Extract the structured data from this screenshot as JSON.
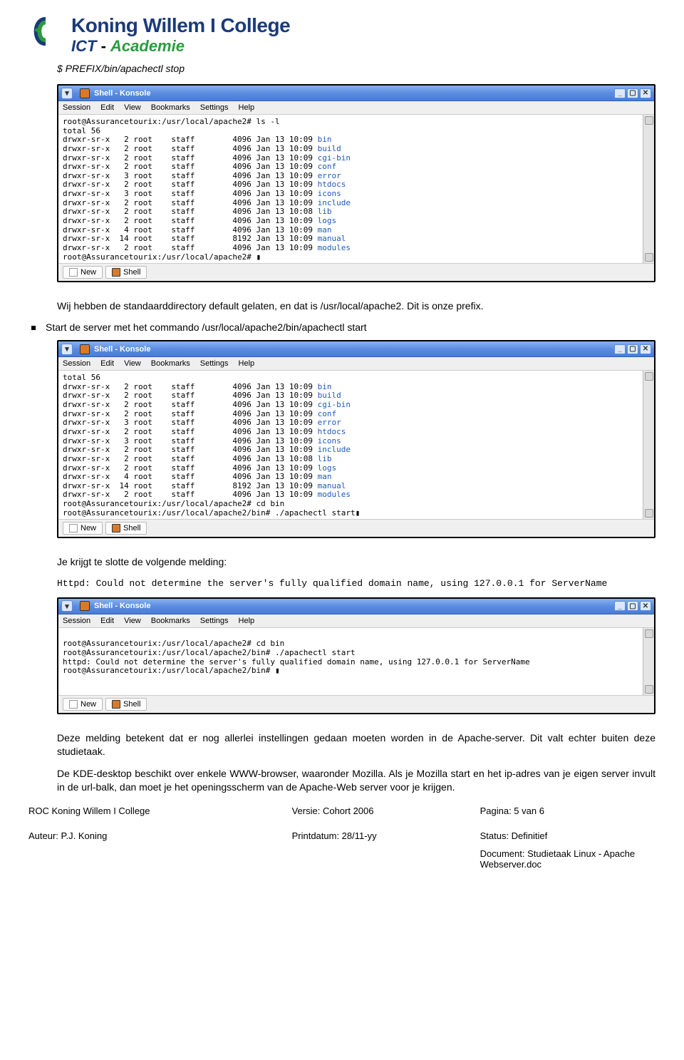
{
  "logo": {
    "title": "Koning Willem I College",
    "sub_ict": "ICT",
    "sub_dash": " - ",
    "sub_acad": "Academie"
  },
  "cmd_stop": "$ PREFIX/bin/apachectl stop",
  "para_prefix": "Wij hebben de standaarddirectory default gelaten, en dat is /usr/local/apache2. Dit is onze prefix.",
  "bullet_start": "Start de server met het commando /usr/local/apache2/bin/apachectl start",
  "para_slotte": "Je krijgt te slotte de volgende melding:",
  "mono_msg": "Httpd: Could not determine the server's fully qualified domain name, using 127.0.0.1 for ServerName",
  "para_melding": "Deze melding betekent dat er nog allerlei instellingen gedaan moeten worden in de Apache-server. Dit valt echter buiten deze studietaak.",
  "para_kde": "De KDE-desktop beschikt over enkele WWW-browser, waaronder Mozilla. Als je Mozilla start en het ip-adres van je eigen server invult in de url-balk, dan moet je het openingsscherm van de Apache-Web server voor je krijgen.",
  "konsole": {
    "title": "Shell - Konsole",
    "menu": [
      "Session",
      "Edit",
      "View",
      "Bookmarks",
      "Settings",
      "Help"
    ],
    "tabs": {
      "new": "New",
      "shell": "Shell"
    }
  },
  "term1": {
    "prompt1": "root@Assurancetourix:/usr/local/apache2# ls -l",
    "total": "total 56",
    "rows": [
      {
        "perm": "drwxr-sr-x",
        "n": "2",
        "own": "root",
        "grp": "staff",
        "size": "4096",
        "date": "Jan 13 10:09",
        "name": "bin"
      },
      {
        "perm": "drwxr-sr-x",
        "n": "2",
        "own": "root",
        "grp": "staff",
        "size": "4096",
        "date": "Jan 13 10:09",
        "name": "build"
      },
      {
        "perm": "drwxr-sr-x",
        "n": "2",
        "own": "root",
        "grp": "staff",
        "size": "4096",
        "date": "Jan 13 10:09",
        "name": "cgi-bin"
      },
      {
        "perm": "drwxr-sr-x",
        "n": "2",
        "own": "root",
        "grp": "staff",
        "size": "4096",
        "date": "Jan 13 10:09",
        "name": "conf"
      },
      {
        "perm": "drwxr-sr-x",
        "n": "3",
        "own": "root",
        "grp": "staff",
        "size": "4096",
        "date": "Jan 13 10:09",
        "name": "error"
      },
      {
        "perm": "drwxr-sr-x",
        "n": "2",
        "own": "root",
        "grp": "staff",
        "size": "4096",
        "date": "Jan 13 10:09",
        "name": "htdocs"
      },
      {
        "perm": "drwxr-sr-x",
        "n": "3",
        "own": "root",
        "grp": "staff",
        "size": "4096",
        "date": "Jan 13 10:09",
        "name": "icons"
      },
      {
        "perm": "drwxr-sr-x",
        "n": "2",
        "own": "root",
        "grp": "staff",
        "size": "4096",
        "date": "Jan 13 10:09",
        "name": "include"
      },
      {
        "perm": "drwxr-sr-x",
        "n": "2",
        "own": "root",
        "grp": "staff",
        "size": "4096",
        "date": "Jan 13 10:08",
        "name": "lib"
      },
      {
        "perm": "drwxr-sr-x",
        "n": "2",
        "own": "root",
        "grp": "staff",
        "size": "4096",
        "date": "Jan 13 10:09",
        "name": "logs"
      },
      {
        "perm": "drwxr-sr-x",
        "n": "4",
        "own": "root",
        "grp": "staff",
        "size": "4096",
        "date": "Jan 13 10:09",
        "name": "man"
      },
      {
        "perm": "drwxr-sr-x",
        "n": "14",
        "own": "root",
        "grp": "staff",
        "size": "8192",
        "date": "Jan 13 10:09",
        "name": "manual"
      },
      {
        "perm": "drwxr-sr-x",
        "n": "2",
        "own": "root",
        "grp": "staff",
        "size": "4096",
        "date": "Jan 13 10:09",
        "name": "modules"
      }
    ],
    "prompt2": "root@Assurancetourix:/usr/local/apache2# ▮"
  },
  "term2": {
    "total": "total 56",
    "extra1": "root@Assurancetourix:/usr/local/apache2# cd bin",
    "extra2": "root@Assurancetourix:/usr/local/apache2/bin# ./apachectl start▮"
  },
  "term3": {
    "l1": "root@Assurancetourix:/usr/local/apache2# cd bin",
    "l2": "root@Assurancetourix:/usr/local/apache2/bin# ./apachectl start",
    "l3": "httpd: Could not determine the server's fully qualified domain name, using 127.0.0.1 for ServerName",
    "l4": "root@Assurancetourix:/usr/local/apache2/bin# ▮"
  },
  "footer": {
    "r1c1": "ROC Koning Willem I College",
    "r1c2": "Versie: Cohort 2006",
    "r1c3": "Pagina: 5 van 6",
    "r2c1": "Auteur: P.J. Koning",
    "r2c2": "Printdatum: 28/11-yy",
    "r2c3a": "Status: Definitief",
    "r2c3b": "Document: Studietaak Linux - Apache Webserver.doc"
  }
}
